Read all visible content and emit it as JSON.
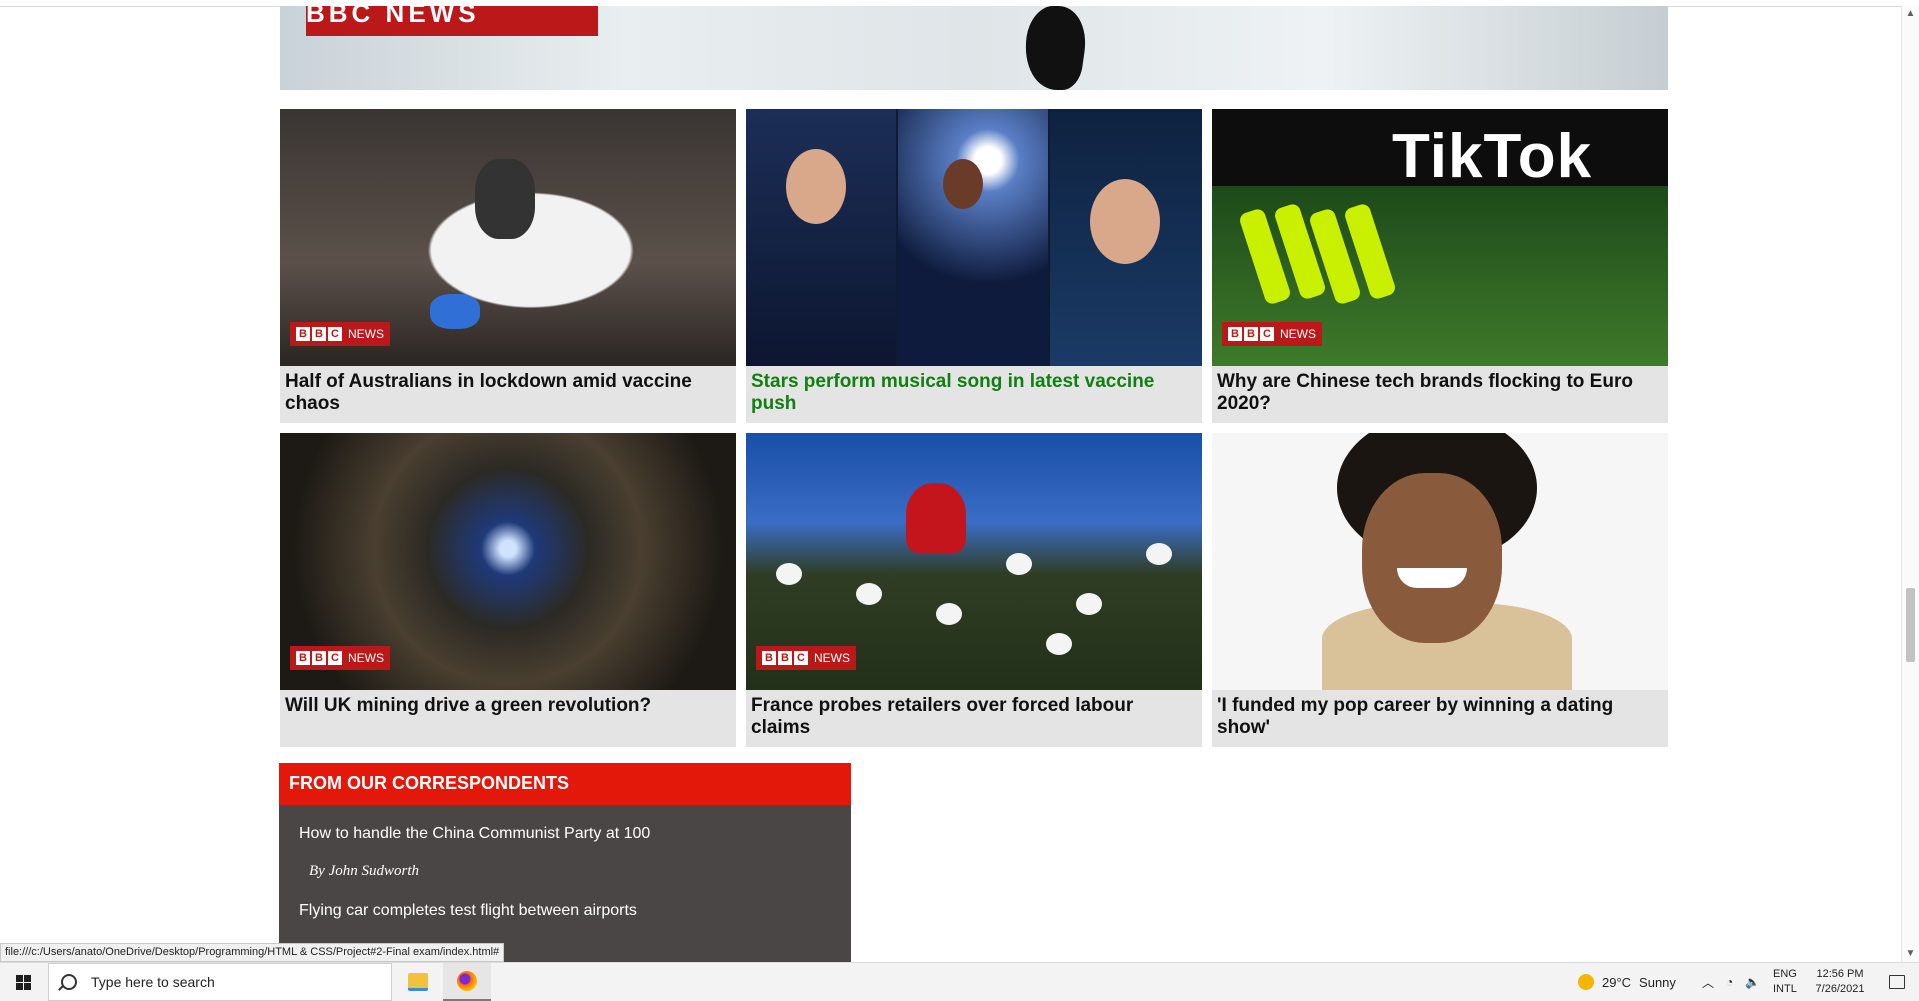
{
  "hero": {
    "badge_text": "BBC NEWS"
  },
  "badges": {
    "b1": "B",
    "b2": "B",
    "b3": "C",
    "news": "NEWS"
  },
  "cards": [
    {
      "caption": "Half of Australians in lockdown amid vaccine chaos",
      "has_badge": true
    },
    {
      "caption": "Stars perform musical song in latest vaccine push",
      "has_badge": false,
      "caption_color": "#108010"
    },
    {
      "caption": "Why are Chinese tech brands flocking to Euro 2020?",
      "has_badge": true,
      "image_text": "TikTok"
    },
    {
      "caption": "Will UK mining drive a green revolution?",
      "has_badge": true
    },
    {
      "caption": "France probes retailers over forced labour claims",
      "has_badge": true
    },
    {
      "caption": "'I funded my pop career by winning a dating show'",
      "has_badge": false
    }
  ],
  "correspondents": {
    "title": "FROM OUR CORRESPONDENTS",
    "items": [
      {
        "headline": "How to handle the China Communist Party at 100",
        "author": "By John Sudworth"
      },
      {
        "headline": "Flying car completes test flight between airports"
      }
    ]
  },
  "status_link": "file:///c:/Users/anato/OneDrive/Desktop/Programming/HTML & CSS/Project#2-Final exam/index.html#",
  "taskbar": {
    "search_placeholder": "Type here to search",
    "weather": {
      "temp": "29°C",
      "condition": "Sunny"
    },
    "lang": {
      "line1": "ENG",
      "line2": "INTL"
    },
    "clock": {
      "time": "12:56 PM",
      "date": "7/26/2021"
    }
  },
  "colors": {
    "bbc_red": "#bb1919",
    "correspondents_header": "#e3170a",
    "correspondents_bg": "#4a4646",
    "card_bg": "#e4e4e4"
  }
}
